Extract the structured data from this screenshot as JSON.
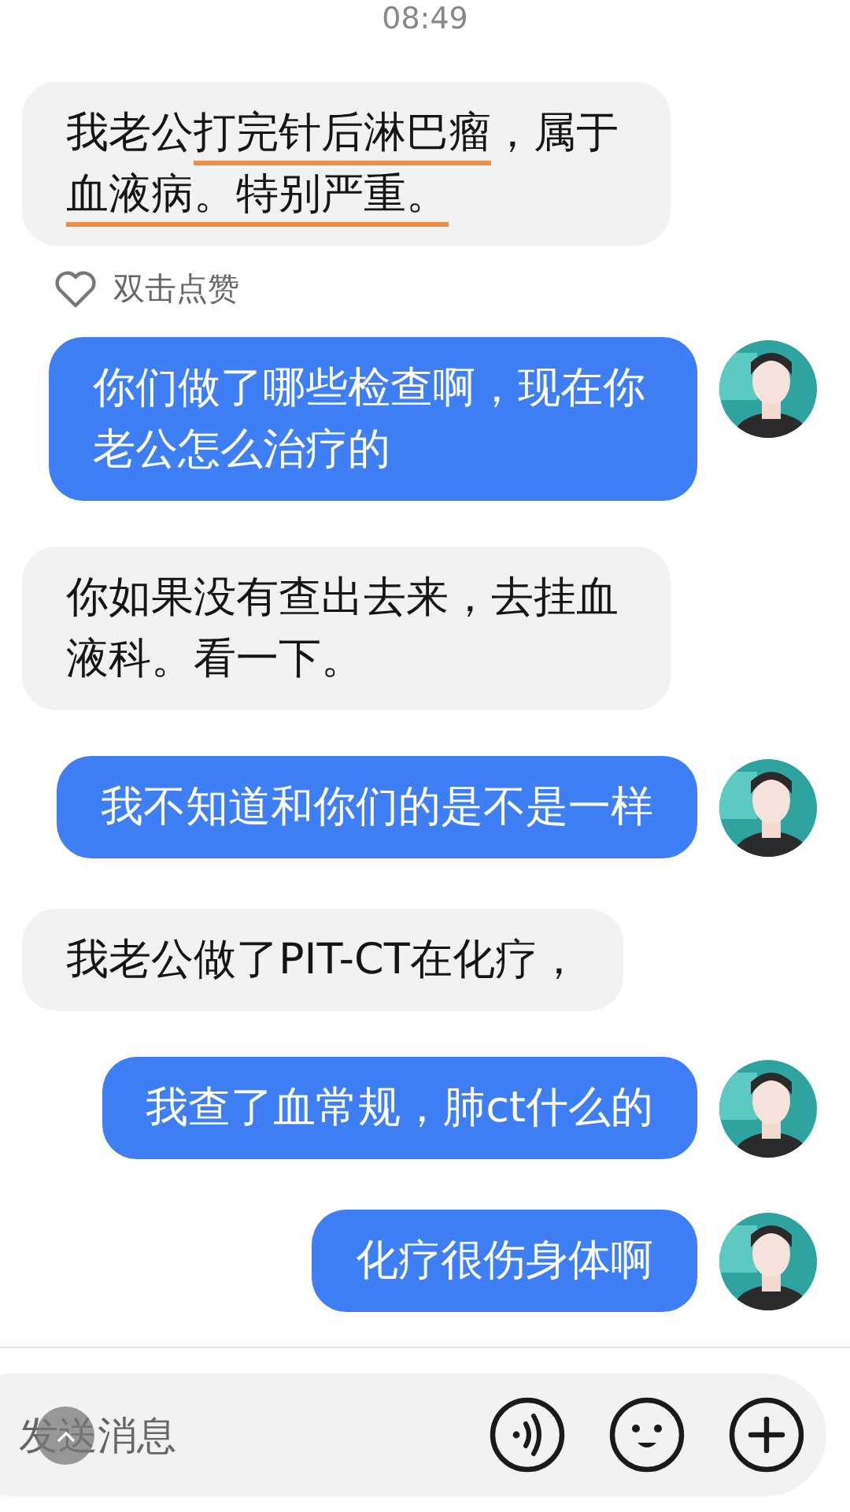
{
  "time": "08:49",
  "messages": [
    {
      "kind": "incoming",
      "segments": [
        {
          "text": "我老公",
          "underlined": false
        },
        {
          "text": "打完针后淋巴瘤",
          "underlined": true
        },
        {
          "text": "，属于",
          "underlined": false
        },
        {
          "text": "血液病。特别严重。",
          "underlined": true
        }
      ],
      "like_hint": "双击点赞"
    },
    {
      "kind": "outgoing",
      "segments": [
        {
          "text": "你们做了哪些检查啊，现在你老公怎么治疗的",
          "underlined": false
        }
      ]
    },
    {
      "kind": "incoming",
      "segments": [
        {
          "text": "你如果没有查出去来，去挂血液科。看一下。",
          "underlined": false
        }
      ]
    },
    {
      "kind": "outgoing",
      "segments": [
        {
          "text": "我不知道和你们的是不是一样",
          "underlined": false
        }
      ]
    },
    {
      "kind": "incoming",
      "segments": [
        {
          "text": "我老公做了PIT-CT在化疗，",
          "underlined": false
        }
      ]
    },
    {
      "kind": "outgoing",
      "segments": [
        {
          "text": "我查了血常规，肺ct什么的",
          "underlined": false
        }
      ]
    },
    {
      "kind": "outgoing",
      "segments": [
        {
          "text": "化疗很伤身体啊",
          "underlined": false
        }
      ]
    }
  ],
  "composer": {
    "placeholder": "发送消息"
  }
}
